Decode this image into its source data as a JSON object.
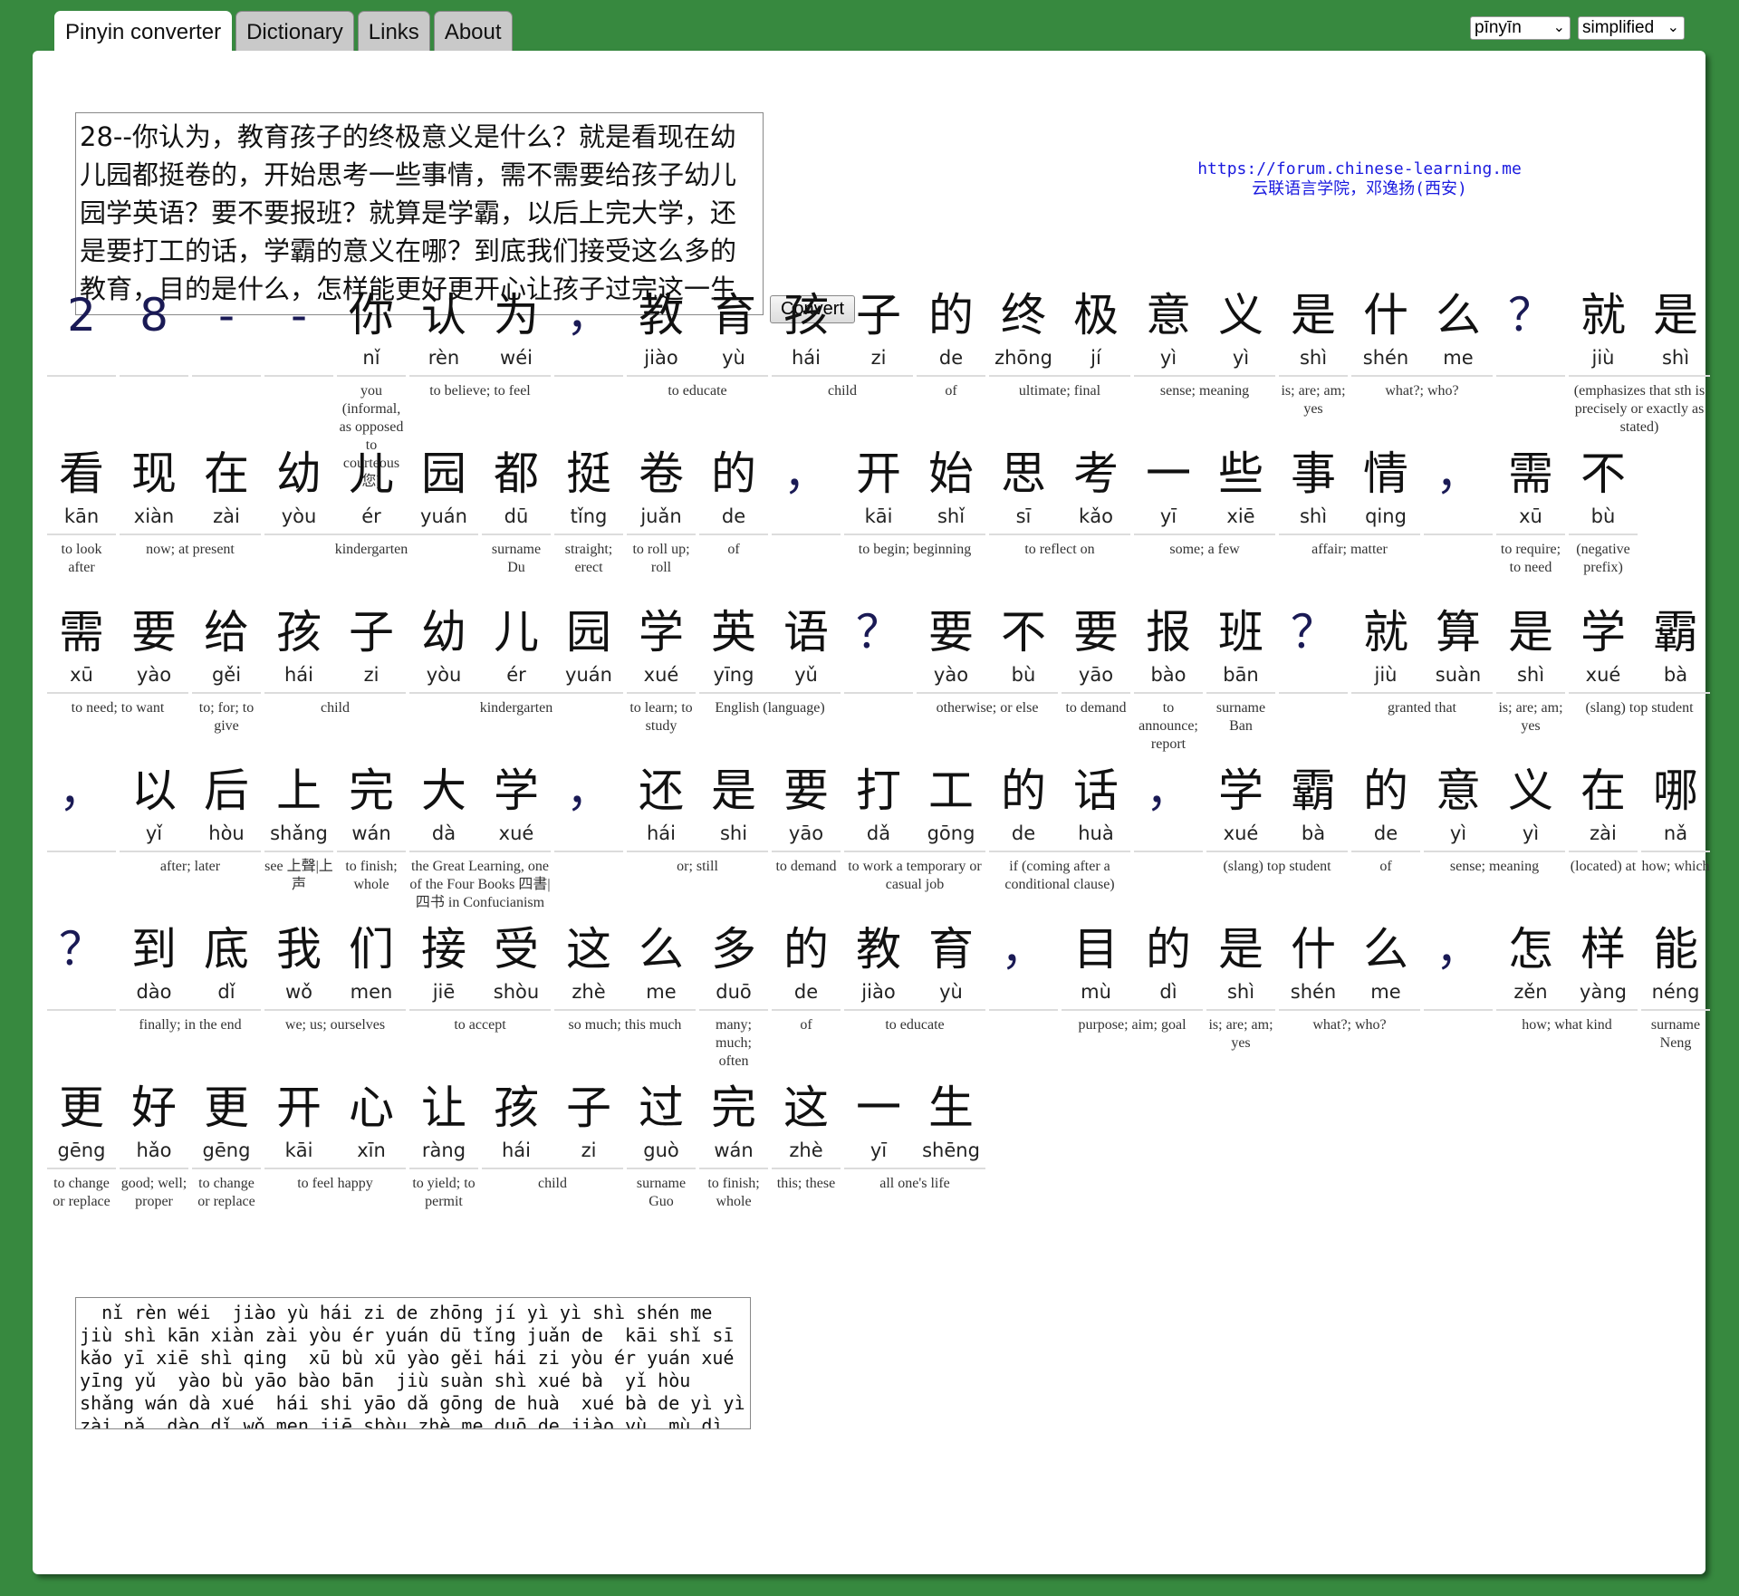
{
  "tabs": [
    "Pinyin converter",
    "Dictionary",
    "Links",
    "About"
  ],
  "selects": {
    "romanization": "pīnyīn",
    "script": "simplified"
  },
  "input_text": "28--你认为，教育孩子的终极意义是什么？就是看现在幼儿园都挺卷的，开始思考一些事情，需不需要给孩子幼儿园学英语？要不要报班？就算是学霸，以后上完大学，还是要打工的话，学霸的意义在哪？到底我们接受这么多的教育，目的是什么，怎样能更好更开心让孩子过完这一生",
  "convert_label": "Convert",
  "credit": {
    "url": "https://forum.chinese-learning.me",
    "school": "云联语言学院，邓逸扬(西安)"
  },
  "rows": [
    {
      "words": [
        {
          "chars": [
            {
              "h": "2"
            }
          ],
          "gloss": ""
        },
        {
          "chars": [
            {
              "h": "8"
            }
          ],
          "gloss": ""
        },
        {
          "chars": [
            {
              "h": "-"
            }
          ],
          "gloss": ""
        },
        {
          "chars": [
            {
              "h": "-"
            }
          ],
          "gloss": ""
        },
        {
          "chars": [
            {
              "h": "你",
              "p": "nǐ"
            }
          ],
          "gloss": "you (informal, as opposed to courteous 您)"
        },
        {
          "chars": [
            {
              "h": "认",
              "p": "rèn"
            },
            {
              "h": "为",
              "p": "wéi"
            }
          ],
          "gloss": "to believe; to feel"
        },
        {
          "chars": [
            {
              "h": "，"
            }
          ],
          "gloss": ""
        },
        {
          "chars": [
            {
              "h": "教",
              "p": "jiào"
            },
            {
              "h": "育",
              "p": "yù"
            }
          ],
          "gloss": "to educate"
        },
        {
          "chars": [
            {
              "h": "孩",
              "p": "hái"
            },
            {
              "h": "子",
              "p": "zi"
            }
          ],
          "gloss": "child"
        },
        {
          "chars": [
            {
              "h": "的",
              "p": "de"
            }
          ],
          "gloss": "of"
        },
        {
          "chars": [
            {
              "h": "终",
              "p": "zhōng"
            },
            {
              "h": "极",
              "p": "jí"
            }
          ],
          "gloss": "ultimate; final"
        },
        {
          "chars": [
            {
              "h": "意",
              "p": "yì"
            },
            {
              "h": "义",
              "p": "yì"
            }
          ],
          "gloss": "sense; meaning"
        },
        {
          "chars": [
            {
              "h": "是",
              "p": "shì"
            }
          ],
          "gloss": "is; are; am; yes"
        },
        {
          "chars": [
            {
              "h": "什",
              "p": "shén"
            },
            {
              "h": "么",
              "p": "me"
            }
          ],
          "gloss": "what?; who?"
        },
        {
          "chars": [
            {
              "h": "？"
            }
          ],
          "gloss": ""
        },
        {
          "chars": [
            {
              "h": "就",
              "p": "jiù"
            },
            {
              "h": "是",
              "p": "shì"
            }
          ],
          "gloss": "(emphasizes that sth is precisely or exactly as stated)"
        }
      ]
    },
    {
      "words": [
        {
          "chars": [
            {
              "h": "看",
              "p": "kān"
            }
          ],
          "gloss": "to look after"
        },
        {
          "chars": [
            {
              "h": "现",
              "p": "xiàn"
            },
            {
              "h": "在",
              "p": "zài"
            }
          ],
          "gloss": "now; at present"
        },
        {
          "chars": [
            {
              "h": "幼",
              "p": "yòu"
            },
            {
              "h": "儿",
              "p": "ér"
            },
            {
              "h": "园",
              "p": "yuán"
            }
          ],
          "gloss": "kindergarten"
        },
        {
          "chars": [
            {
              "h": "都",
              "p": "dū"
            }
          ],
          "gloss": "surname Du"
        },
        {
          "chars": [
            {
              "h": "挺",
              "p": "tǐng"
            }
          ],
          "gloss": "straight; erect"
        },
        {
          "chars": [
            {
              "h": "卷",
              "p": "juǎn"
            }
          ],
          "gloss": "to roll up; roll"
        },
        {
          "chars": [
            {
              "h": "的",
              "p": "de"
            }
          ],
          "gloss": "of"
        },
        {
          "chars": [
            {
              "h": "，"
            }
          ],
          "gloss": ""
        },
        {
          "chars": [
            {
              "h": "开",
              "p": "kāi"
            },
            {
              "h": "始",
              "p": "shǐ"
            }
          ],
          "gloss": "to begin; beginning"
        },
        {
          "chars": [
            {
              "h": "思",
              "p": "sī"
            },
            {
              "h": "考",
              "p": "kǎo"
            }
          ],
          "gloss": "to reflect on"
        },
        {
          "chars": [
            {
              "h": "一",
              "p": "yī"
            },
            {
              "h": "些",
              "p": "xiē"
            }
          ],
          "gloss": "some; a few"
        },
        {
          "chars": [
            {
              "h": "事",
              "p": "shì"
            },
            {
              "h": "情",
              "p": "qing"
            }
          ],
          "gloss": "affair; matter"
        },
        {
          "chars": [
            {
              "h": "，"
            }
          ],
          "gloss": ""
        },
        {
          "chars": [
            {
              "h": "需",
              "p": "xū"
            }
          ],
          "gloss": "to require; to need"
        },
        {
          "chars": [
            {
              "h": "不",
              "p": "bù"
            }
          ],
          "gloss": "(negative prefix)"
        }
      ]
    },
    {
      "words": [
        {
          "chars": [
            {
              "h": "需",
              "p": "xū"
            },
            {
              "h": "要",
              "p": "yào"
            }
          ],
          "gloss": "to need; to want"
        },
        {
          "chars": [
            {
              "h": "给",
              "p": "gěi"
            }
          ],
          "gloss": "to; for; to give"
        },
        {
          "chars": [
            {
              "h": "孩",
              "p": "hái"
            },
            {
              "h": "子",
              "p": "zi"
            }
          ],
          "gloss": "child"
        },
        {
          "chars": [
            {
              "h": "幼",
              "p": "yòu"
            },
            {
              "h": "儿",
              "p": "ér"
            },
            {
              "h": "园",
              "p": "yuán"
            }
          ],
          "gloss": "kindergarten"
        },
        {
          "chars": [
            {
              "h": "学",
              "p": "xué"
            }
          ],
          "gloss": "to learn; to study"
        },
        {
          "chars": [
            {
              "h": "英",
              "p": "yīng"
            },
            {
              "h": "语",
              "p": "yǔ"
            }
          ],
          "gloss": "English (language)"
        },
        {
          "chars": [
            {
              "h": "？"
            }
          ],
          "gloss": ""
        },
        {
          "chars": [
            {
              "h": "要",
              "p": "yào"
            },
            {
              "h": "不",
              "p": "bù"
            }
          ],
          "gloss": "otherwise; or else"
        },
        {
          "chars": [
            {
              "h": "要",
              "p": "yāo"
            }
          ],
          "gloss": "to demand"
        },
        {
          "chars": [
            {
              "h": "报",
              "p": "bào"
            }
          ],
          "gloss": "to announce; report"
        },
        {
          "chars": [
            {
              "h": "班",
              "p": "bān"
            }
          ],
          "gloss": "surname Ban"
        },
        {
          "chars": [
            {
              "h": "？"
            }
          ],
          "gloss": ""
        },
        {
          "chars": [
            {
              "h": "就",
              "p": "jiù"
            },
            {
              "h": "算",
              "p": "suàn"
            }
          ],
          "gloss": "granted that"
        },
        {
          "chars": [
            {
              "h": "是",
              "p": "shì"
            }
          ],
          "gloss": "is; are; am; yes"
        },
        {
          "chars": [
            {
              "h": "学",
              "p": "xué"
            },
            {
              "h": "霸",
              "p": "bà"
            }
          ],
          "gloss": "(slang) top student"
        }
      ]
    },
    {
      "words": [
        {
          "chars": [
            {
              "h": "，"
            }
          ],
          "gloss": ""
        },
        {
          "chars": [
            {
              "h": "以",
              "p": "yǐ"
            },
            {
              "h": "后",
              "p": "hòu"
            }
          ],
          "gloss": "after; later"
        },
        {
          "chars": [
            {
              "h": "上",
              "p": "shǎng"
            }
          ],
          "gloss": "see 上聲|上声"
        },
        {
          "chars": [
            {
              "h": "完",
              "p": "wán"
            }
          ],
          "gloss": "to finish; whole"
        },
        {
          "chars": [
            {
              "h": "大",
              "p": "dà"
            },
            {
              "h": "学",
              "p": "xué"
            }
          ],
          "gloss": "the Great Learning, one of the Four Books 四書|四书 in Confucianism"
        },
        {
          "chars": [
            {
              "h": "，"
            }
          ],
          "gloss": ""
        },
        {
          "chars": [
            {
              "h": "还",
              "p": "hái"
            },
            {
              "h": "是",
              "p": "shi"
            }
          ],
          "gloss": "or; still"
        },
        {
          "chars": [
            {
              "h": "要",
              "p": "yāo"
            }
          ],
          "gloss": "to demand"
        },
        {
          "chars": [
            {
              "h": "打",
              "p": "dǎ"
            },
            {
              "h": "工",
              "p": "gōng"
            }
          ],
          "gloss": "to work a temporary or casual job"
        },
        {
          "chars": [
            {
              "h": "的",
              "p": "de"
            },
            {
              "h": "话",
              "p": "huà"
            }
          ],
          "gloss": "if (coming after a conditional clause)"
        },
        {
          "chars": [
            {
              "h": "，"
            }
          ],
          "gloss": ""
        },
        {
          "chars": [
            {
              "h": "学",
              "p": "xué"
            },
            {
              "h": "霸",
              "p": "bà"
            }
          ],
          "gloss": "(slang) top student"
        },
        {
          "chars": [
            {
              "h": "的",
              "p": "de"
            }
          ],
          "gloss": "of"
        },
        {
          "chars": [
            {
              "h": "意",
              "p": "yì"
            },
            {
              "h": "义",
              "p": "yì"
            }
          ],
          "gloss": "sense; meaning"
        },
        {
          "chars": [
            {
              "h": "在",
              "p": "zài"
            }
          ],
          "gloss": "(located) at"
        },
        {
          "chars": [
            {
              "h": "哪",
              "p": "nǎ"
            }
          ],
          "gloss": "how; which"
        }
      ]
    },
    {
      "words": [
        {
          "chars": [
            {
              "h": "？"
            }
          ],
          "gloss": ""
        },
        {
          "chars": [
            {
              "h": "到",
              "p": "dào"
            },
            {
              "h": "底",
              "p": "dǐ"
            }
          ],
          "gloss": "finally; in the end"
        },
        {
          "chars": [
            {
              "h": "我",
              "p": "wǒ"
            },
            {
              "h": "们",
              "p": "men"
            }
          ],
          "gloss": "we; us; ourselves"
        },
        {
          "chars": [
            {
              "h": "接",
              "p": "jiē"
            },
            {
              "h": "受",
              "p": "shòu"
            }
          ],
          "gloss": "to accept"
        },
        {
          "chars": [
            {
              "h": "这",
              "p": "zhè"
            },
            {
              "h": "么",
              "p": "me"
            }
          ],
          "gloss": "so much; this much"
        },
        {
          "chars": [
            {
              "h": "多",
              "p": "duō"
            }
          ],
          "gloss": "many; much; often"
        },
        {
          "chars": [
            {
              "h": "的",
              "p": "de"
            }
          ],
          "gloss": "of"
        },
        {
          "chars": [
            {
              "h": "教",
              "p": "jiào"
            },
            {
              "h": "育",
              "p": "yù"
            }
          ],
          "gloss": "to educate"
        },
        {
          "chars": [
            {
              "h": "，"
            }
          ],
          "gloss": ""
        },
        {
          "chars": [
            {
              "h": "目",
              "p": "mù"
            },
            {
              "h": "的",
              "p": "dì"
            }
          ],
          "gloss": "purpose; aim; goal"
        },
        {
          "chars": [
            {
              "h": "是",
              "p": "shì"
            }
          ],
          "gloss": "is; are; am; yes"
        },
        {
          "chars": [
            {
              "h": "什",
              "p": "shén"
            },
            {
              "h": "么",
              "p": "me"
            }
          ],
          "gloss": "what?; who?"
        },
        {
          "chars": [
            {
              "h": "，"
            }
          ],
          "gloss": ""
        },
        {
          "chars": [
            {
              "h": "怎",
              "p": "zěn"
            },
            {
              "h": "样",
              "p": "yàng"
            }
          ],
          "gloss": "how; what kind"
        },
        {
          "chars": [
            {
              "h": "能",
              "p": "néng"
            }
          ],
          "gloss": "surname Neng"
        }
      ]
    },
    {
      "words": [
        {
          "chars": [
            {
              "h": "更",
              "p": "gēng"
            }
          ],
          "gloss": "to change or replace"
        },
        {
          "chars": [
            {
              "h": "好",
              "p": "hǎo"
            }
          ],
          "gloss": "good; well; proper"
        },
        {
          "chars": [
            {
              "h": "更",
              "p": "gēng"
            }
          ],
          "gloss": "to change or replace"
        },
        {
          "chars": [
            {
              "h": "开",
              "p": "kāi"
            },
            {
              "h": "心",
              "p": "xīn"
            }
          ],
          "gloss": "to feel happy"
        },
        {
          "chars": [
            {
              "h": "让",
              "p": "ràng"
            }
          ],
          "gloss": "to yield; to permit"
        },
        {
          "chars": [
            {
              "h": "孩",
              "p": "hái"
            },
            {
              "h": "子",
              "p": "zi"
            }
          ],
          "gloss": "child"
        },
        {
          "chars": [
            {
              "h": "过",
              "p": "guò"
            }
          ],
          "gloss": "surname Guo"
        },
        {
          "chars": [
            {
              "h": "完",
              "p": "wán"
            }
          ],
          "gloss": "to finish; whole"
        },
        {
          "chars": [
            {
              "h": "这",
              "p": "zhè"
            }
          ],
          "gloss": "this; these"
        },
        {
          "chars": [
            {
              "h": "一",
              "p": "yī"
            },
            {
              "h": "生",
              "p": "shēng"
            }
          ],
          "gloss": "all one's life"
        }
      ]
    }
  ],
  "output_text": "  nǐ rèn wéi  jiào yù hái zi de zhōng jí yì yì shì shén me  jiù shì kān xiàn zài yòu ér yuán dū tǐng juǎn de  kāi shǐ sī kǎo yī xiē shì qing  xū bù xū yào gěi hái zi yòu ér yuán xué yīng yǔ  yào bù yāo bào bān  jiù suàn shì xué bà  yǐ hòu shǎng wán dà xué  hái shi yāo dǎ gōng de huà  xué bà de yì yì zài nǎ  dào dǐ wǒ men jiē shòu zhè me duō de jiào yù  mù dì shì shén me  zěn yàng néng gēng hǎo gēng kāi xīn ràng hái zi guò wán zhè yī shēng"
}
